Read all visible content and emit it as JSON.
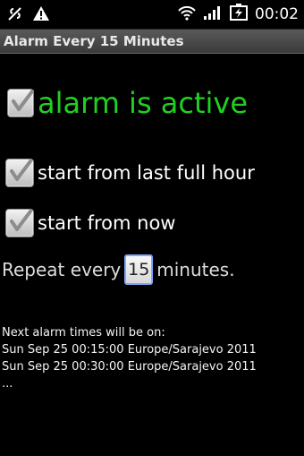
{
  "status_bar": {
    "time": "00:02",
    "icons": [
      "usb-debugging-icon",
      "warning-icon",
      "wifi-icon",
      "signal-icon",
      "battery-charging-icon"
    ]
  },
  "app": {
    "title": "Alarm Every 15 Minutes"
  },
  "alarm": {
    "label": "alarm is active",
    "checked": true
  },
  "options": [
    {
      "label": "start from last full hour",
      "checked": true
    },
    {
      "label": "start from now",
      "checked": true
    }
  ],
  "repeat": {
    "prefix": "Repeat every",
    "value": "15",
    "suffix": "minutes."
  },
  "next_alarms": {
    "heading": "Next alarm times will be on:",
    "times": [
      "Sun Sep 25 00:15:00 Europe/Sarajevo 2011",
      "Sun Sep 25 00:30:00 Europe/Sarajevo 2011"
    ],
    "more": "..."
  },
  "colors": {
    "accent_green": "#1fd21f",
    "background": "#000000"
  }
}
